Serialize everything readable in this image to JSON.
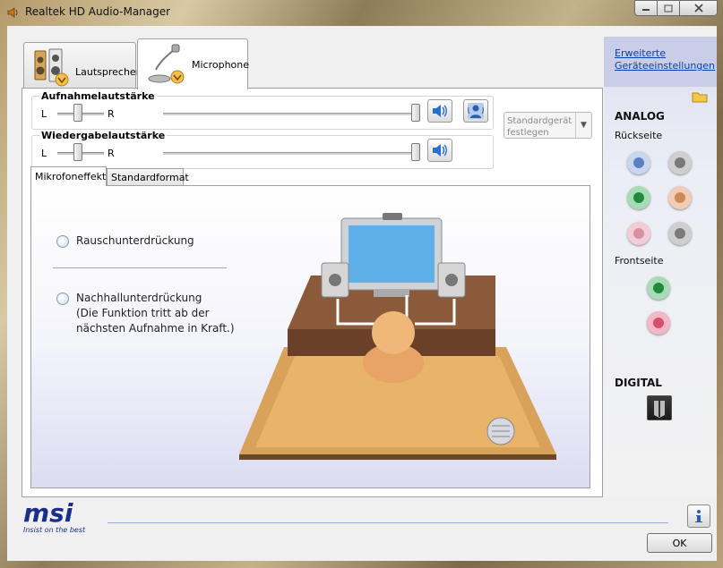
{
  "window": {
    "title": "Realtek HD Audio-Manager"
  },
  "device_tabs": [
    {
      "label": "Lautsprecher",
      "selected": false
    },
    {
      "label": "Microphone",
      "selected": true
    }
  ],
  "recording_volume": {
    "title": "Aufnahmelautstärke",
    "left": "L",
    "right": "R"
  },
  "playback_volume": {
    "title": "Wiedergabelautstärke",
    "left": "L",
    "right": "R"
  },
  "standard_device": {
    "label": "Standardgerät festlegen",
    "enabled": false
  },
  "inner_tabs": [
    {
      "label": "Mikrofoneffekt",
      "selected": true
    },
    {
      "label": "Standardformat",
      "selected": false
    }
  ],
  "effects": {
    "noise_suppression": "Rauschunterdrückung",
    "echo_line1": "Nachhallunterdrückung",
    "echo_line2": "(Die Funktion tritt ab der",
    "echo_line3": "nächsten Aufnahme in Kraft.)"
  },
  "side_panel": {
    "advanced_link_line1": "Erweiterte",
    "advanced_link_line2": "Geräteeinstellungen",
    "analog": "ANALOG",
    "rear": "Rückseite",
    "front": "Frontseite",
    "digital": "DIGITAL",
    "colors": {
      "blue": "#5b7fc4",
      "gray": "#7a7a7a",
      "green": "#1f8a3c",
      "orange": "#d08a5a",
      "pink": "#d890a0",
      "front_pink": "#d44f6a"
    }
  },
  "footer": {
    "brand": "msi",
    "tagline": "Insist on the best",
    "ok_label": "OK"
  }
}
